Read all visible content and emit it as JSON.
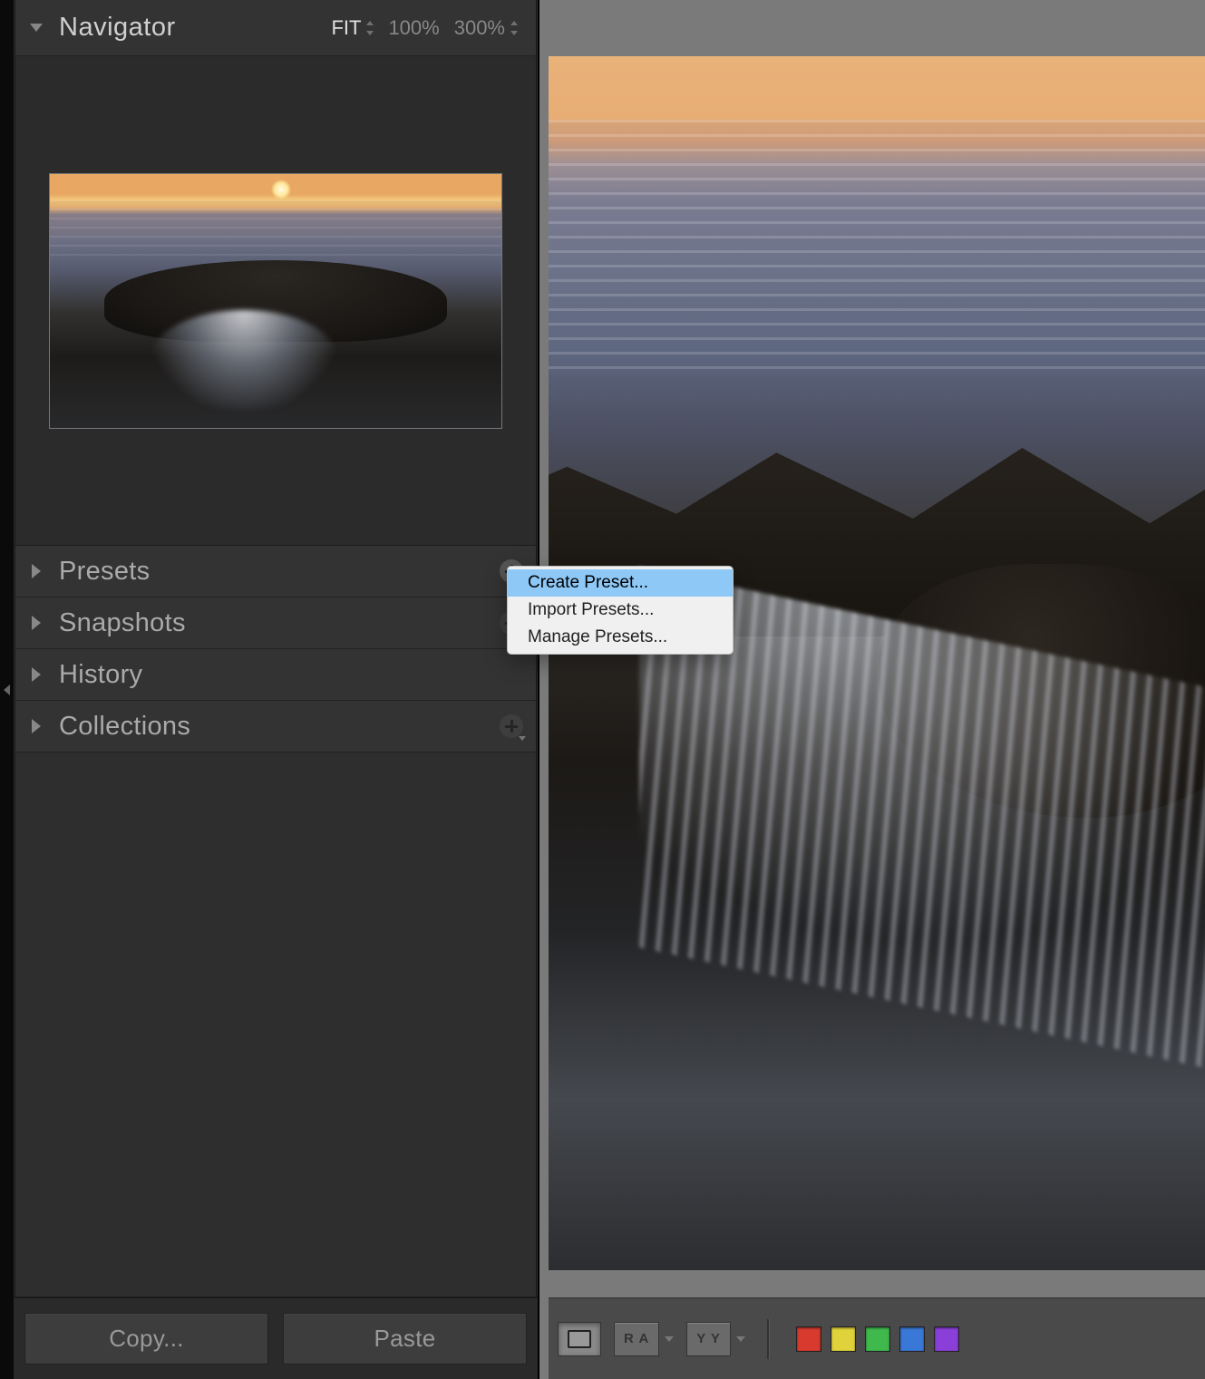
{
  "navigator": {
    "title": "Navigator",
    "zoom": {
      "fit": "FIT",
      "z100": "100%",
      "z300": "300%"
    }
  },
  "panels": {
    "presets": "Presets",
    "snapshots": "Snapshots",
    "history": "History",
    "collections": "Collections"
  },
  "buttons": {
    "copy": "Copy...",
    "paste": "Paste"
  },
  "context_menu": {
    "create": "Create Preset...",
    "import": "Import Presets...",
    "manage": "Manage Presets..."
  },
  "toolbar": {
    "view_ra": "R A",
    "view_yy": "Y Y"
  },
  "swatches": {
    "red": "#d83a2e",
    "yellow": "#e0d23a",
    "green": "#3fb94c",
    "blue": "#3a78d8",
    "purple": "#8a3fd8"
  }
}
